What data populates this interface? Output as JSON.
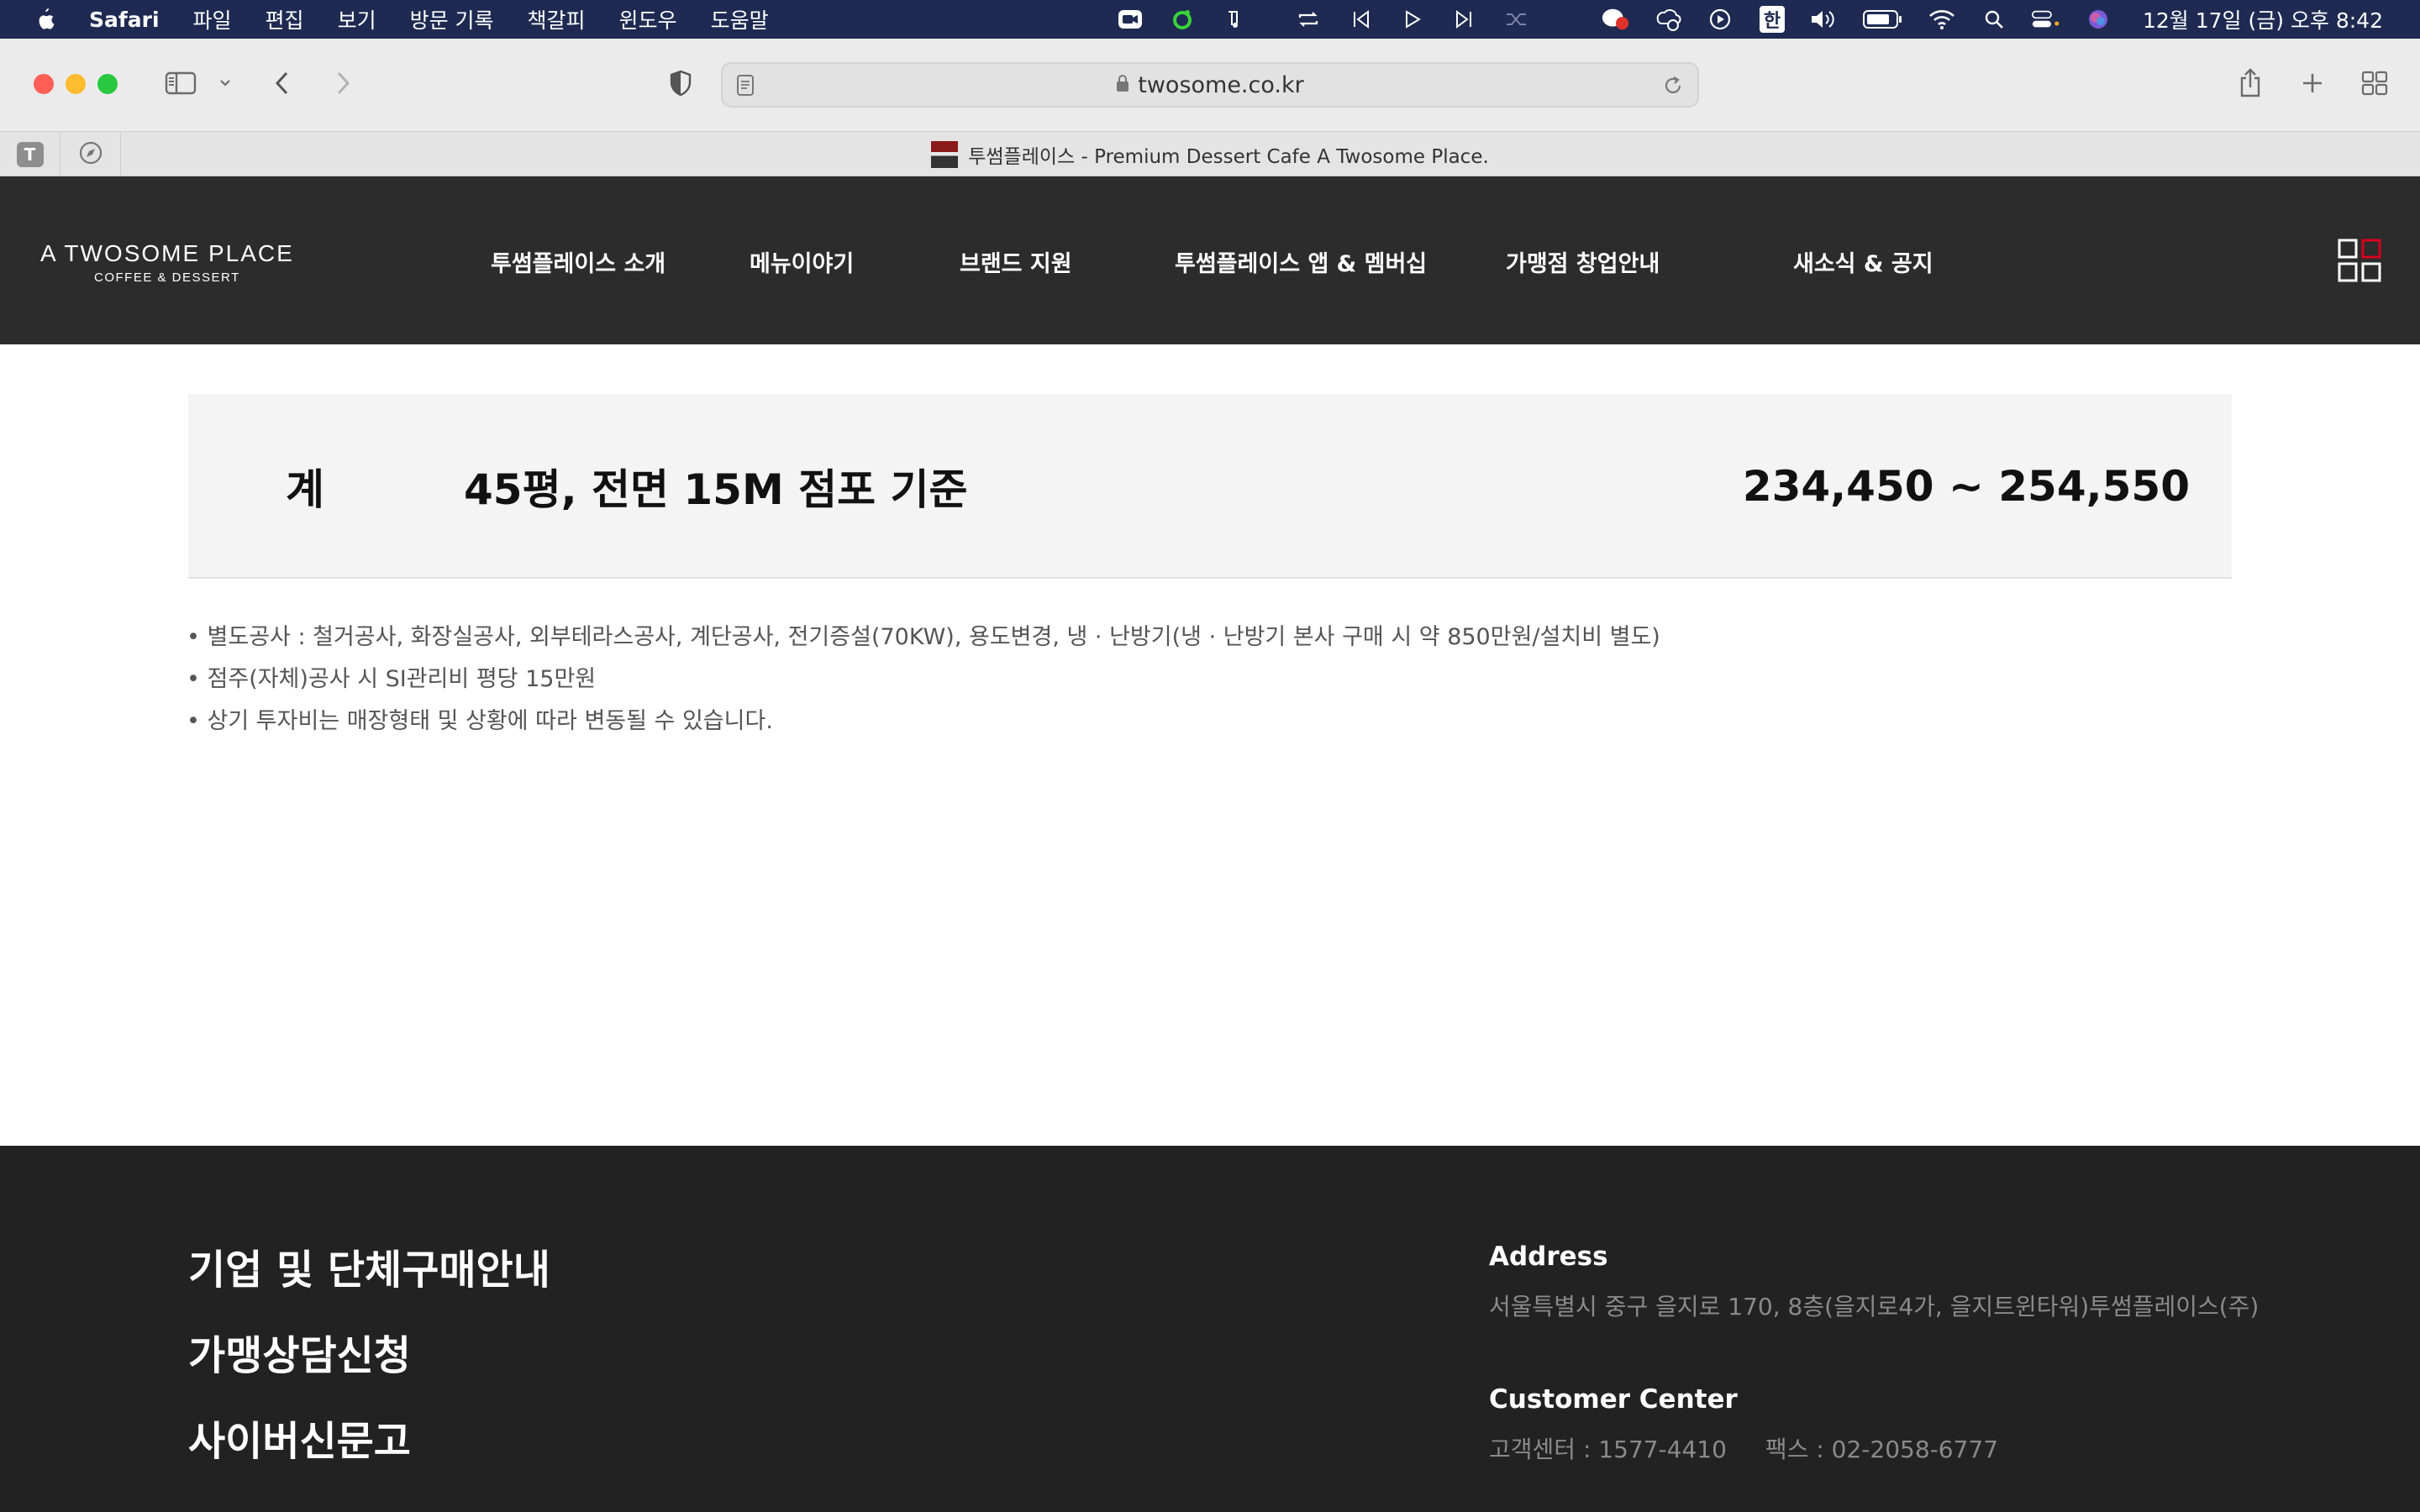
{
  "menubar": {
    "app_name": "Safari",
    "items": [
      "파일",
      "편집",
      "보기",
      "방문 기록",
      "책갈피",
      "윈도우",
      "도움말"
    ],
    "clock": "12월 17일 (금) 오후 8:42",
    "ime": "한"
  },
  "browser": {
    "url": "twosome.co.kr",
    "tab_title": "투썸플레이스 - Premium Dessert Cafe A Twosome Place.",
    "pinned_tab_letter": "T"
  },
  "site": {
    "logo_line1": "A TWOSOME PLACE",
    "logo_line2": "COFFEE & DESSERT",
    "nav": [
      "투썸플레이스 소개",
      "메뉴이야기",
      "브랜드 지원",
      "투썸플레이스 앱 & 멤버십",
      "가맹점 창업안내",
      "새소식 & 공지"
    ]
  },
  "total": {
    "label": "계",
    "description": "45평, 전면 15M 점포 기준",
    "value": "234,450 ~ 254,550"
  },
  "notes": [
    "• 별도공사 : 철거공사, 화장실공사, 외부테라스공사, 계단공사, 전기증설(70KW), 용도변경, 냉 · 난방기(냉 · 난방기 본사 구매 시 약 850만원/설치비 별도)",
    "• 점주(자체)공사 시 SI관리비 평당 15만원",
    "• 상기 투자비는 매장형태 및 상황에 따라 변동될 수 있습니다."
  ],
  "footer": {
    "links": [
      "기업 및 단체구매안내",
      "가맹상담신청",
      "사이버신문고"
    ],
    "address_heading": "Address",
    "address": "서울특별시 중구 을지로 170, 8층(을지로4가, 을지트윈타워)투썸플레이스(주)",
    "cs_heading": "Customer Center",
    "phone": "고객센터 : 1577-4410",
    "fax": "팩스 : 02-2058-6777"
  },
  "colors": {
    "menubar_bg": "#1e2a52",
    "header_bg": "#2c2c2c",
    "footer_bg": "#222222",
    "total_bg": "#f4f4f4",
    "accent_red": "#d6001c"
  }
}
